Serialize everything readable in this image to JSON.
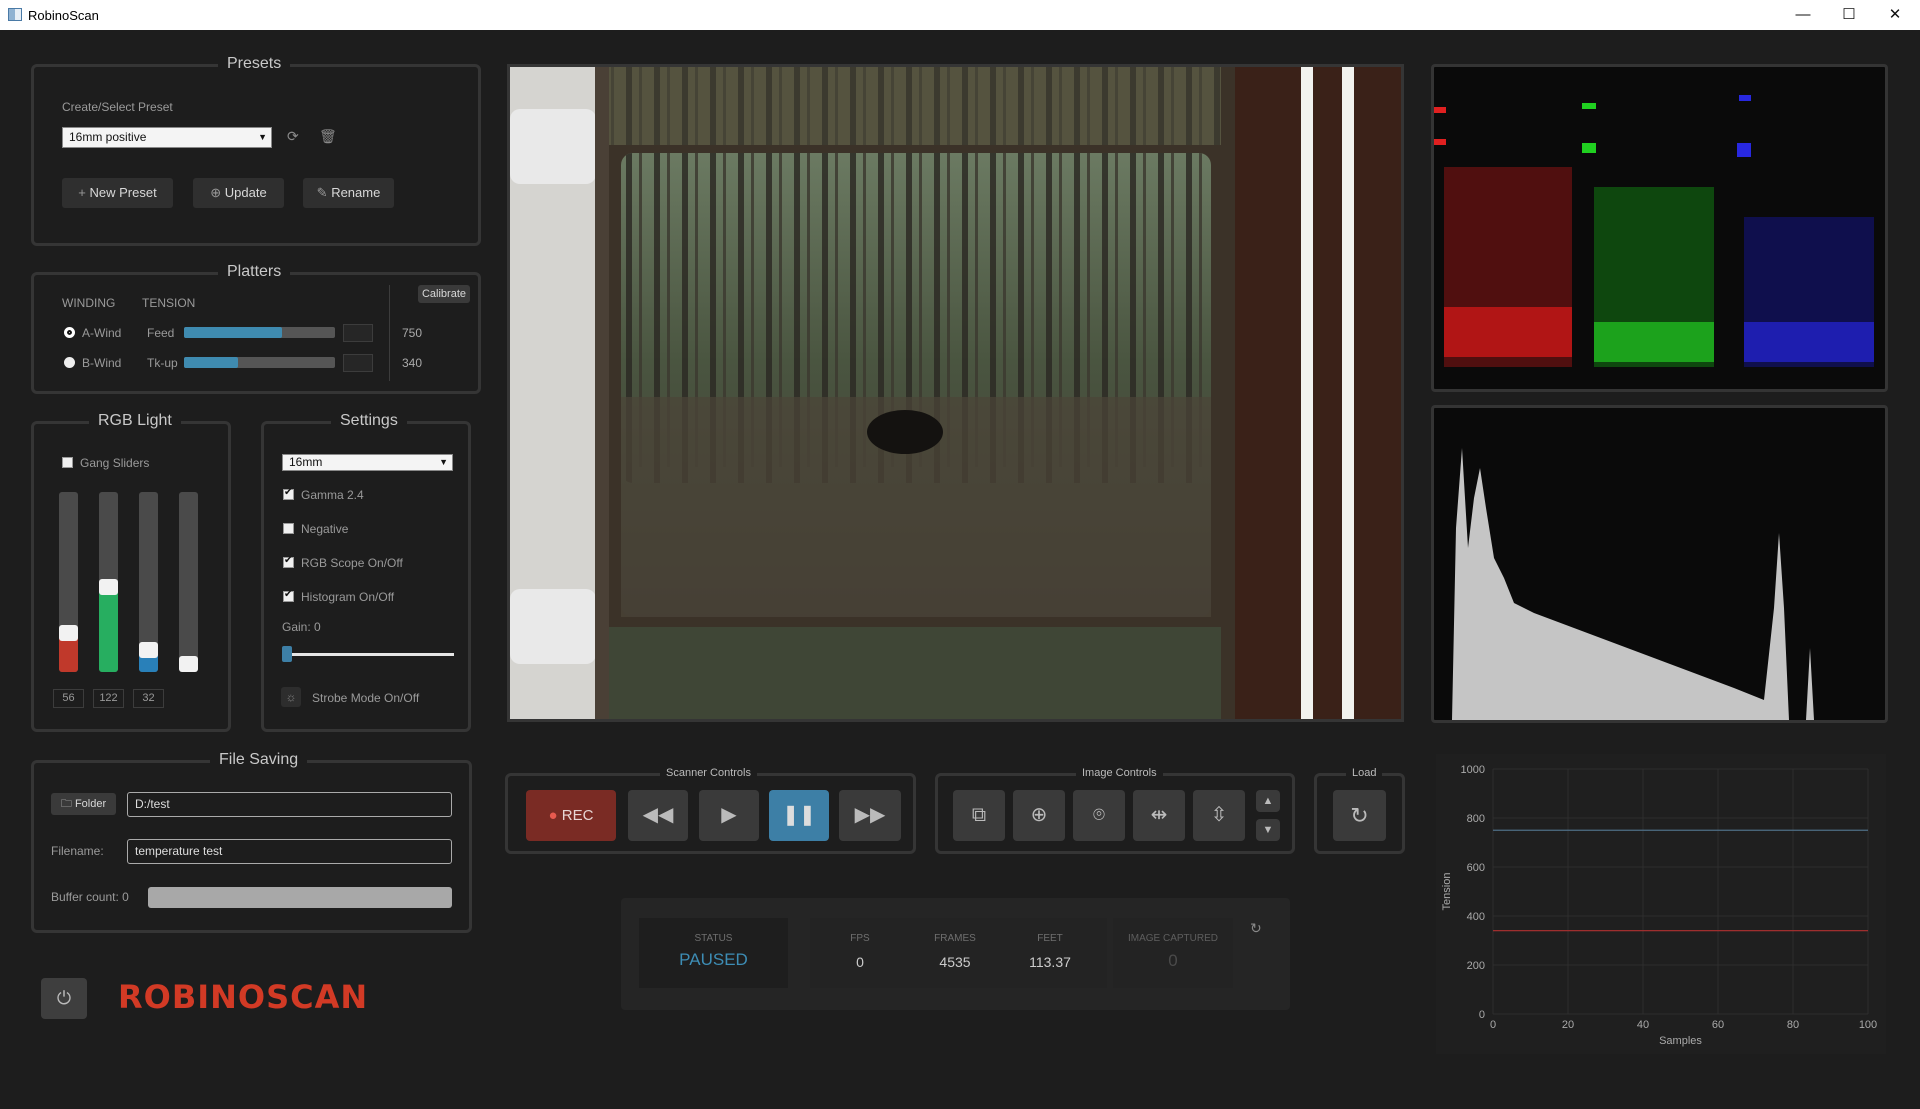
{
  "window": {
    "title": "RobinoScan",
    "min": "—",
    "max": "☐",
    "close": "✕"
  },
  "presets": {
    "title": "Presets",
    "create_label": "Create/Select Preset",
    "selected": "16mm positive",
    "new_label": "New Preset",
    "update_label": "Update",
    "rename_label": "Rename"
  },
  "platters": {
    "title": "Platters",
    "winding_label": "WINDING",
    "tension_label": "TENSION",
    "calibrate_label": "Calibrate",
    "a_wind": "A-Wind",
    "b_wind": "B-Wind",
    "feed_label": "Feed",
    "tkup_label": "Tk-up",
    "feed_value": "750",
    "tkup_value": "340",
    "feed_level": 0.65,
    "tkup_level": 0.36,
    "selected": "A-Wind"
  },
  "rgb_light": {
    "title": "RGB Light",
    "gang_label": "Gang Sliders",
    "gang_checked": false,
    "sliders": [
      {
        "color": "#c0392b",
        "level": 0.22,
        "value": "56"
      },
      {
        "color": "#27ae60",
        "level": 0.48,
        "value": "122"
      },
      {
        "color": "#2980b9",
        "level": 0.13,
        "value": "32"
      },
      {
        "color": "#dddddd",
        "level": 0.0,
        "value": ""
      }
    ]
  },
  "settings": {
    "title": "Settings",
    "format": "16mm",
    "gamma": "Gamma 2.4",
    "negative": "Negative",
    "rgb_scope": "RGB Scope On/Off",
    "histogram": "Histogram On/Off",
    "gain_label": "Gain: 0",
    "strobe": "Strobe Mode On/Off",
    "gamma_checked": true,
    "negative_checked": false,
    "rgb_scope_checked": true,
    "histogram_checked": true,
    "gain_level": 0.0
  },
  "file_saving": {
    "title": "File Saving",
    "folder_label": "Folder",
    "folder_path": "D:/test",
    "filename_label": "Filename:",
    "filename": "temperature test",
    "buffer_label": "Buffer count: 0"
  },
  "logo": "ROBINOSCAN",
  "scanner_controls": {
    "title": "Scanner Controls",
    "rec_label": "REC"
  },
  "image_controls": {
    "title": "Image Controls"
  },
  "load": {
    "title": "Load"
  },
  "status": {
    "status_label": "STATUS",
    "status_value": "PAUSED",
    "fps_label": "FPS",
    "fps_value": "0",
    "frames_label": "FRAMES",
    "frames_value": "4535",
    "feet_label": "FEET",
    "feet_value": "113.37",
    "captured_label": "IMAGE CAPTURED",
    "captured_value": "0"
  },
  "chart_data": {
    "type": "line",
    "xlabel": "Samples",
    "ylabel": "Tension",
    "xlim": [
      0,
      100
    ],
    "ylim": [
      0,
      1000
    ],
    "x_ticks": [
      0,
      20,
      40,
      60,
      80,
      100
    ],
    "y_ticks": [
      0,
      200,
      400,
      600,
      800,
      1000
    ],
    "series": [
      {
        "values": [
          750,
          750
        ],
        "x": [
          0,
          100
        ],
        "color": "#4e6e86"
      },
      {
        "values": [
          340,
          340
        ],
        "x": [
          0,
          100
        ],
        "color": "#b03030"
      }
    ]
  },
  "colors": {
    "accent": "#3d7fa6",
    "rec": "#7a2b24",
    "logo": "#d23a25"
  }
}
